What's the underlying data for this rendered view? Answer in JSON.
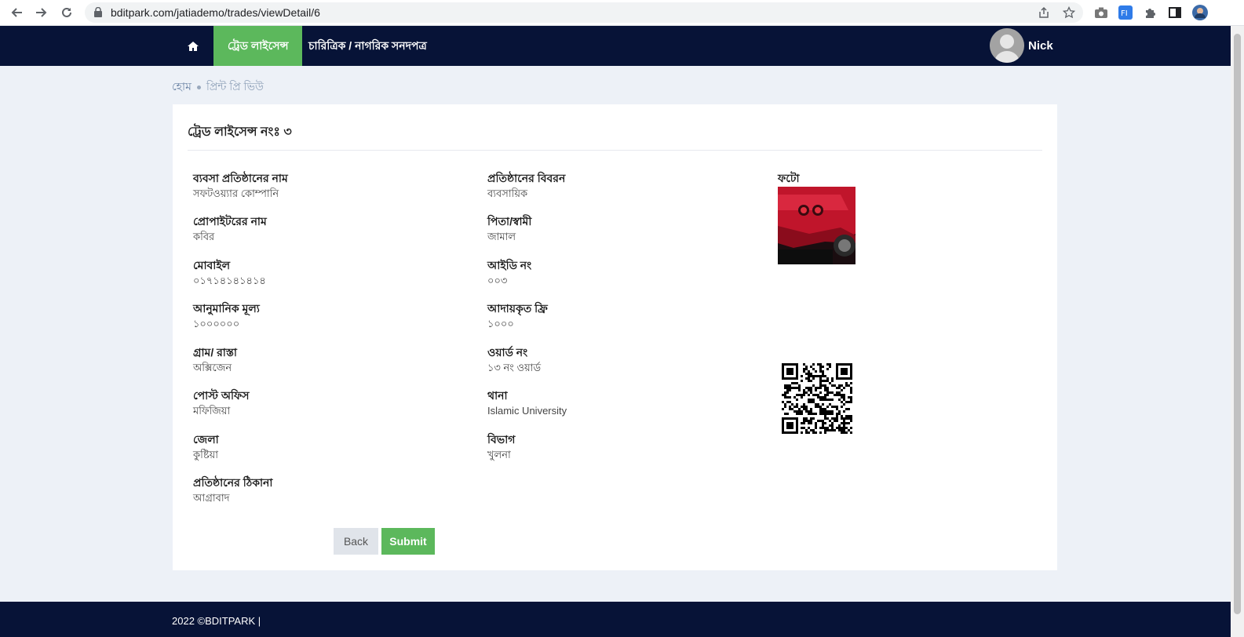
{
  "browser": {
    "url": "bditpark.com/jatiademo/trades/viewDetail/6"
  },
  "nav": {
    "items": [
      {
        "label": "ট্রেড লাইসেন্স"
      },
      {
        "label": "চারিত্রিক / নাগরিক সনদপত্র"
      }
    ],
    "user_name": "Nick"
  },
  "breadcrumb": {
    "home": "হোম",
    "current": "প্রিন্ট প্রি ভিউ"
  },
  "card": {
    "title": "ট্রেড লাইসেন্স নংঃ ৩"
  },
  "fields_left": [
    {
      "label": "ব্যবসা প্রতিষ্ঠানের নাম",
      "value": "সফটওয়্যার কোম্পানি"
    },
    {
      "label": "প্রোপাইটরের নাম",
      "value": "কবির"
    },
    {
      "label": "মোবাইল",
      "value": "০১৭১৪১৪১৪১৪"
    },
    {
      "label": "আনুমানিক মূল্য",
      "value": "১০০০০০০"
    },
    {
      "label": "গ্রাম/ রাস্তা",
      "value": "অক্সিজেন"
    },
    {
      "label": "পোস্ট অফিস",
      "value": "মফিজিয়া"
    },
    {
      "label": "জেলা",
      "value": "কুষ্টিয়া"
    },
    {
      "label": "প্রতিষ্ঠানের ঠিকানা",
      "value": "আগ্রাবাদ"
    }
  ],
  "fields_mid": [
    {
      "label": "প্রতিষ্ঠানের বিবরন",
      "value": "ব্যবসায়িক"
    },
    {
      "label": "পিতা/স্বামী",
      "value": "জামাল"
    },
    {
      "label": "আইডি নং",
      "value": "০০৩"
    },
    {
      "label": "আদায়কৃত ফ্রি",
      "value": "১০০০"
    },
    {
      "label": "ওয়ার্ড নং",
      "value": "১৩ নং ওয়ার্ড"
    },
    {
      "label": "থানা",
      "value": "Islamic University"
    },
    {
      "label": "বিভাগ",
      "value": "খুলনা"
    }
  ],
  "photo": {
    "label": "ফটো"
  },
  "buttons": {
    "back": "Back",
    "submit": "Submit"
  },
  "footer": {
    "text": "2022 ©BDITPARK  |"
  },
  "colors": {
    "navbar": "#071337",
    "accent": "#5cb85c",
    "background": "#edf1f7"
  }
}
